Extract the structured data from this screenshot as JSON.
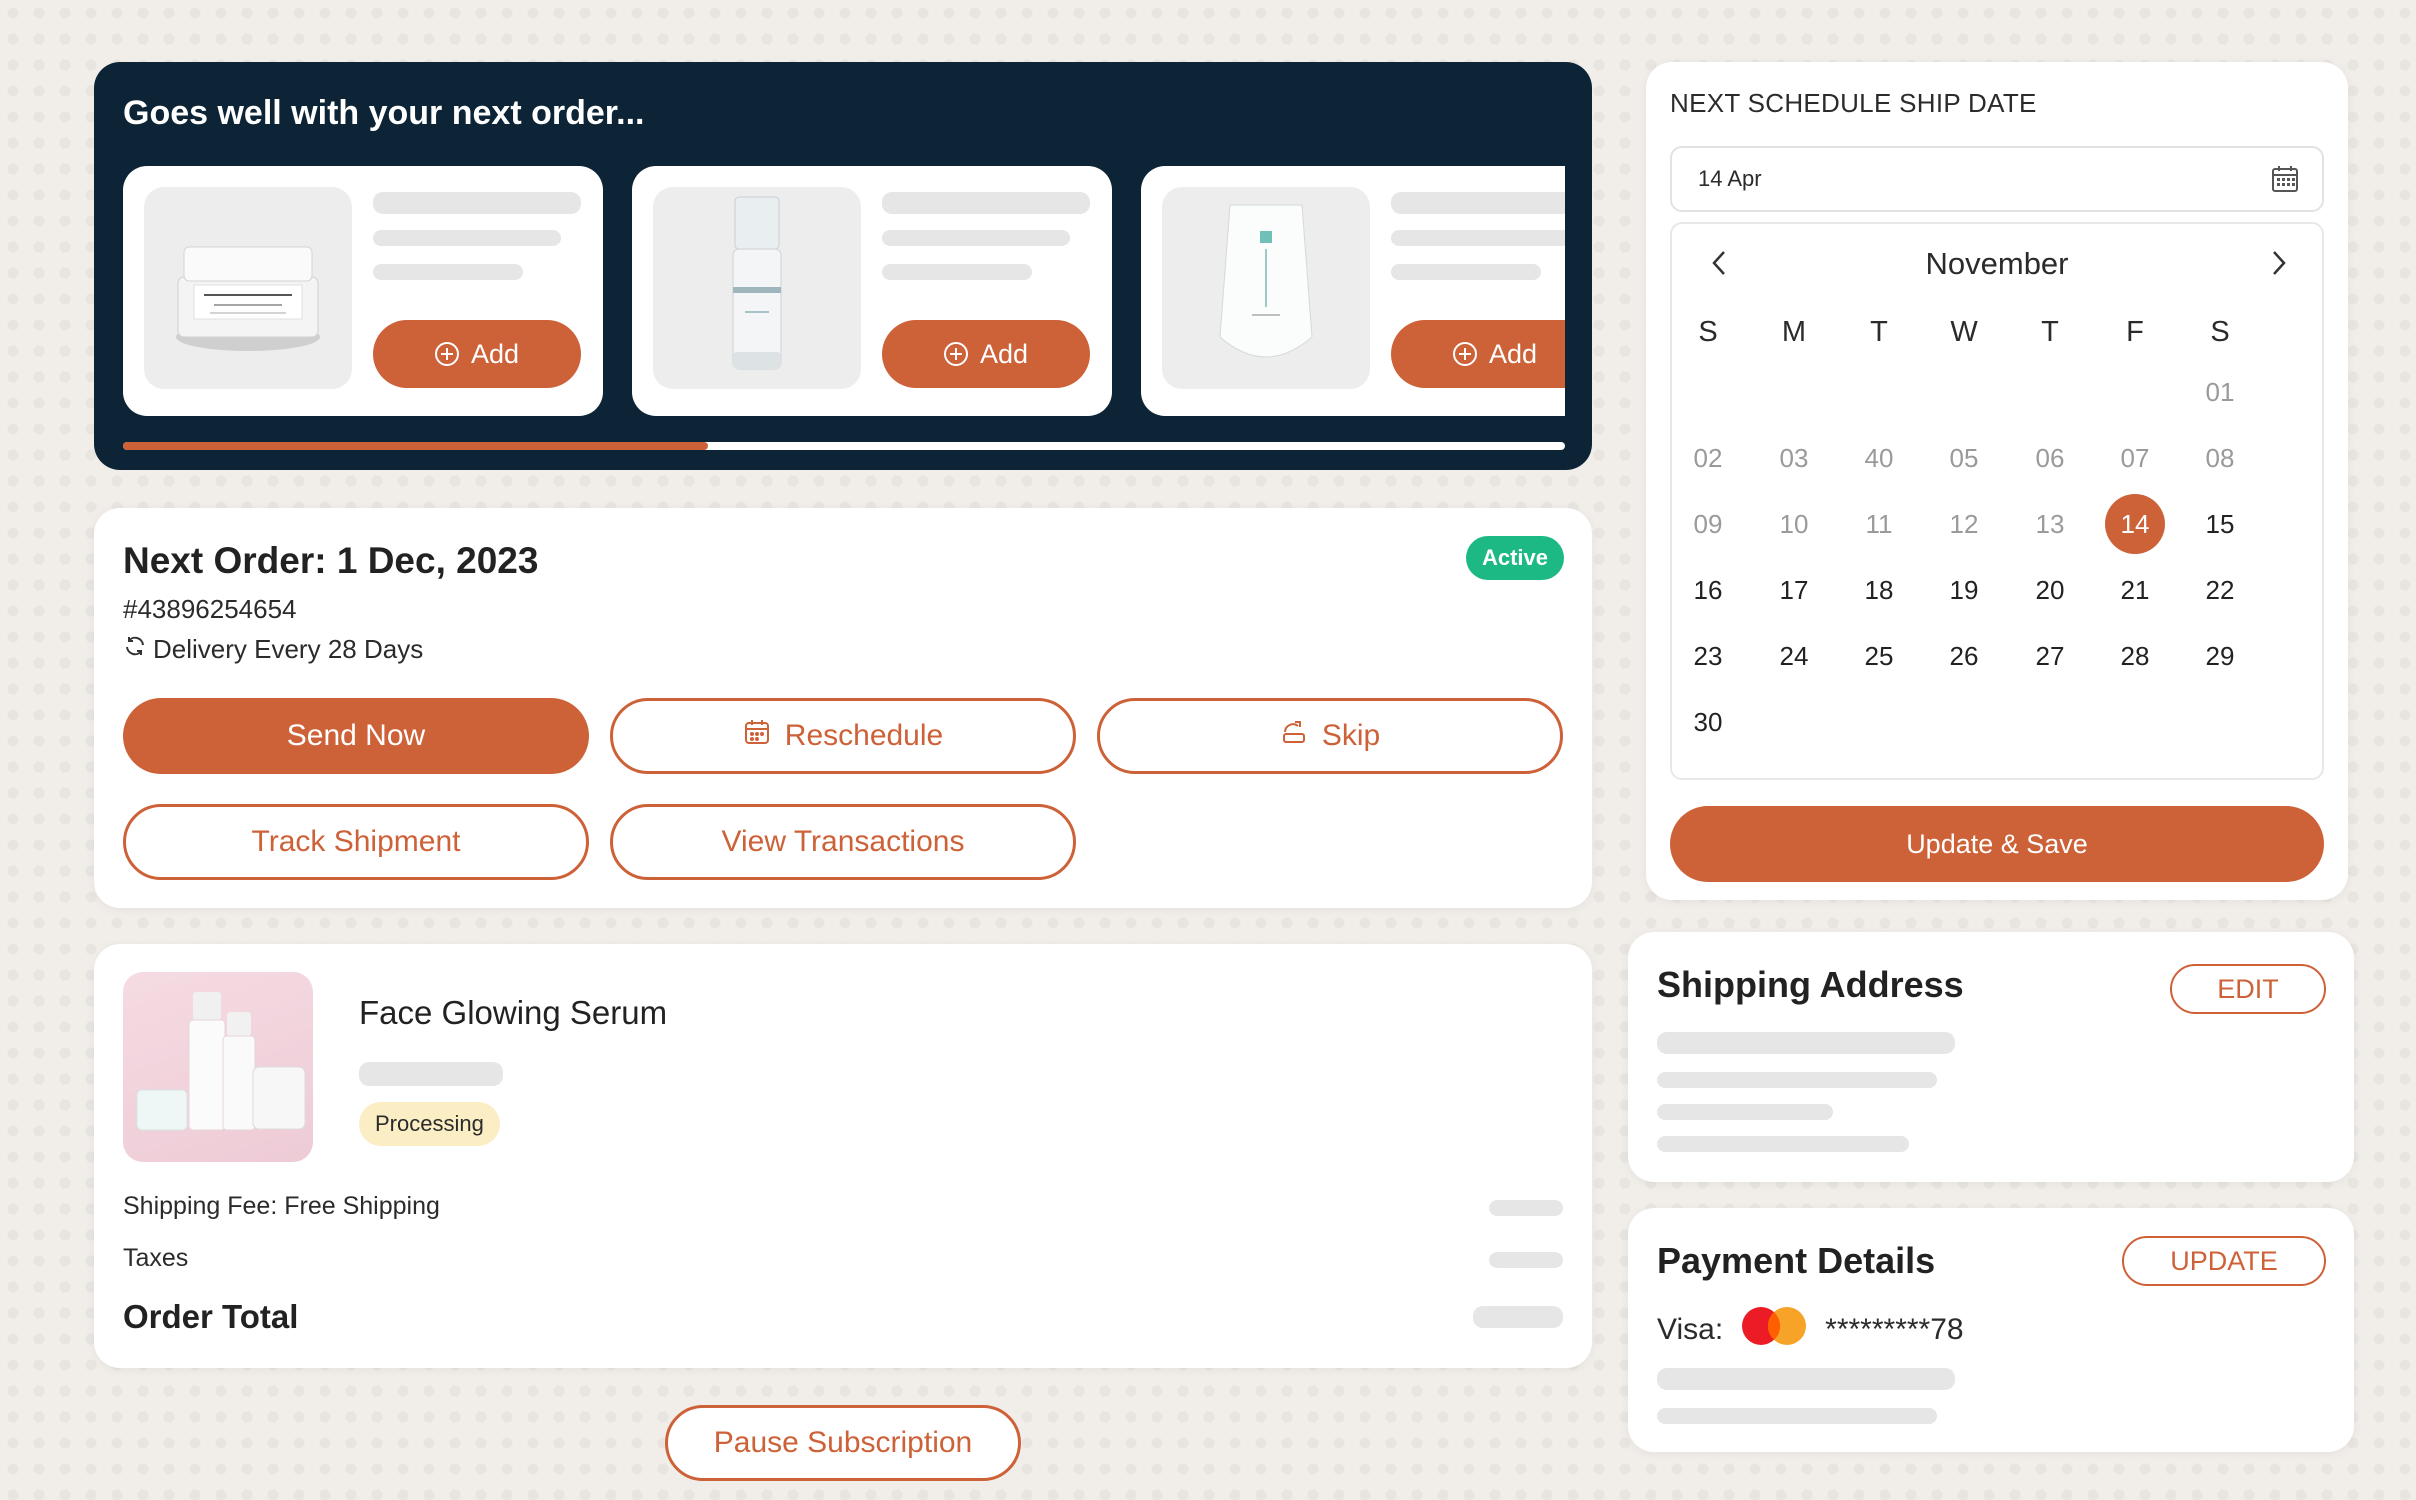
{
  "upsell": {
    "title": "Goes well with your next order...",
    "add_label": "Add",
    "products": [
      {
        "image": "face-cream-jar",
        "action": "Add"
      },
      {
        "image": "serum-bottle",
        "action": "Add"
      },
      {
        "image": "cream-tube",
        "action": "Add"
      }
    ],
    "scroll_progress": 0.4
  },
  "order": {
    "title": "Next Order: 1 Dec, 2023",
    "number": "#43896254654",
    "frequency": "Delivery Every 28 Days",
    "status": "Active",
    "buttons": {
      "send_now": "Send Now",
      "reschedule": "Reschedule",
      "skip": "Skip",
      "track": "Track Shipment",
      "transactions": "View Transactions"
    }
  },
  "item": {
    "name": "Face Glowing Serum",
    "status": "Processing",
    "shipping_fee": "Shipping Fee: Free Shipping",
    "taxes": "Taxes",
    "order_total": "Order Total"
  },
  "pause_label": "Pause Subscription",
  "schedule": {
    "label": "NEXT SCHEDULE SHIP DATE",
    "date_value": "14 Apr",
    "month": "November",
    "weekdays": [
      "S",
      "M",
      "T",
      "W",
      "T",
      "F",
      "S"
    ],
    "weeks": [
      [
        "",
        "",
        "",
        "",
        "",
        "",
        "01"
      ],
      [
        "02",
        "03",
        "40",
        "05",
        "06",
        "07",
        "08"
      ],
      [
        "09",
        "10",
        "11",
        "12",
        "13",
        "14",
        "15"
      ],
      [
        "16",
        "17",
        "18",
        "19",
        "20",
        "21",
        "22"
      ],
      [
        "23",
        "24",
        "25",
        "26",
        "27",
        "28",
        "29"
      ],
      [
        "30",
        "",
        "",
        "",
        "",
        "",
        ""
      ]
    ],
    "selected_day": "14",
    "save_label": "Update & Save"
  },
  "shipping": {
    "title": "Shipping Address",
    "edit_label": "EDIT"
  },
  "payment": {
    "title": "Payment Details",
    "update_label": "UPDATE",
    "card_label": "Visa:",
    "card_number": "*********78"
  },
  "colors": {
    "accent": "#cd6138",
    "navy": "#0c2435",
    "active": "#1db984",
    "processing_bg": "#fbeec4"
  }
}
